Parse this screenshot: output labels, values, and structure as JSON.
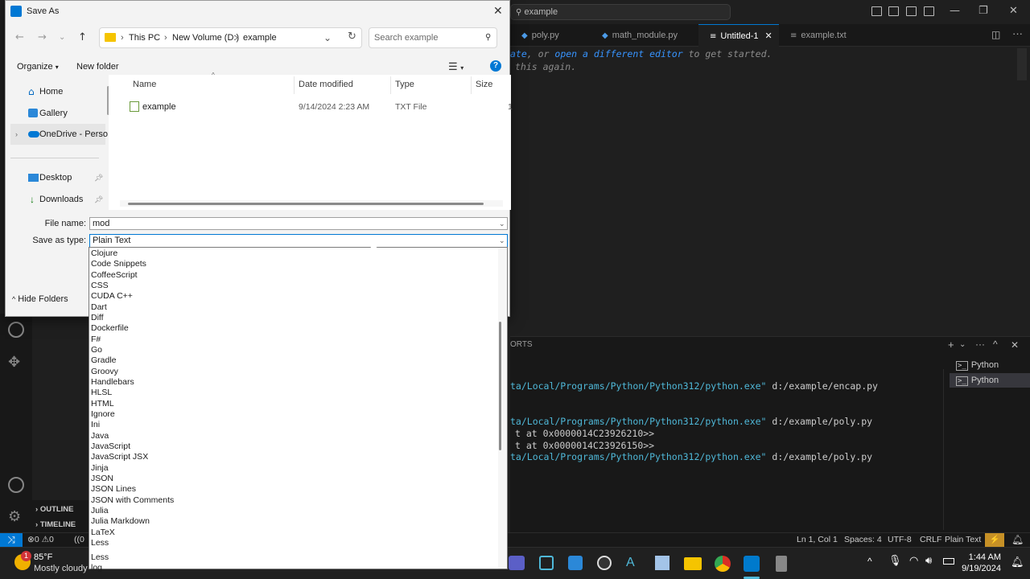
{
  "vscode": {
    "search": "example",
    "tabs": [
      {
        "label": "poly.py",
        "icon": "python-icon"
      },
      {
        "label": "math_module.py",
        "icon": "python-icon"
      },
      {
        "label": "Untitled-1",
        "icon": "menu-lines-icon",
        "active": true
      },
      {
        "label": "example.txt",
        "icon": "menu-lines-icon"
      }
    ],
    "editor_hint_1_a": "ate",
    "editor_hint_1_b": ", or ",
    "editor_hint_1_c": "open a different editor",
    "editor_hint_1_d": " to get started.",
    "editor_hint_2": "this again.",
    "panel_tab": "ORTS",
    "terminals": [
      "Python",
      "Python"
    ],
    "terminal_lines": [
      {
        "path": "ta/Local/Programs/Python/Python312/python.exe\"",
        "rest": " d:/example/encap.py"
      },
      {
        "path": "ta/Local/Programs/Python/Python312/python.exe\"",
        "rest": " d:/example/poly.py"
      },
      {
        "path": "",
        "rest": "t at 0x0000014C23926210>>"
      },
      {
        "path": "",
        "rest": "t at 0x0000014C23926150>>"
      },
      {
        "path": "ta/Local/Programs/Python/Python312/python.exe\"",
        "rest": " d:/example/poly.py"
      }
    ],
    "outline": "OUTLINE",
    "timeline": "TIMELINE",
    "status": {
      "errors": "0",
      "warnings": "0",
      "ports": "0",
      "position": "Ln 1, Col 1",
      "spaces": "Spaces: 4",
      "encoding": "UTF-8",
      "eol": "CRLF",
      "language": "Plain Text"
    }
  },
  "dialog": {
    "title": "Save As",
    "breadcrumb": [
      "This PC",
      "New Volume (D:)",
      "example"
    ],
    "search_placeholder": "Search example",
    "organize": "Organize",
    "new_folder": "New folder",
    "nav_items": [
      {
        "label": "Home",
        "icon": "home-icon"
      },
      {
        "label": "Gallery",
        "icon": "gallery-icon"
      },
      {
        "label": "OneDrive - Perso",
        "icon": "cloud-icon"
      },
      {
        "label": "Desktop",
        "icon": "desktop-icon"
      },
      {
        "label": "Downloads",
        "icon": "download-icon"
      }
    ],
    "columns": [
      "Name",
      "Date modified",
      "Type",
      "Size"
    ],
    "files": [
      {
        "name": "example",
        "date": "9/14/2024 2:23 AM",
        "type": "TXT File",
        "size": "1"
      }
    ],
    "file_name_label": "File name:",
    "file_name_value": "mod",
    "save_type_label": "Save as type:",
    "save_type_value": "Plain Text",
    "hide_folders": "Hide Folders",
    "type_options": [
      "Clojure",
      "Code Snippets",
      "CoffeeScript",
      "CSS",
      "CUDA C++",
      "Dart",
      "Diff",
      "Dockerfile",
      "F#",
      "Go",
      "Gradle",
      "Groovy",
      "Handlebars",
      "HLSL",
      "HTML",
      "Ignore",
      "Ini",
      "Java",
      "JavaScript",
      "JavaScript JSX",
      "Jinja",
      "JSON",
      "JSON Lines",
      "JSON with Comments",
      "Julia",
      "Julia Markdown",
      "LaTeX",
      "Less",
      "Less",
      "log"
    ]
  },
  "taskbar": {
    "weather_badge": "1",
    "temperature": "85°F",
    "weather_text": "Mostly cloudy",
    "time": "1:44 AM",
    "date": "9/19/2024"
  }
}
